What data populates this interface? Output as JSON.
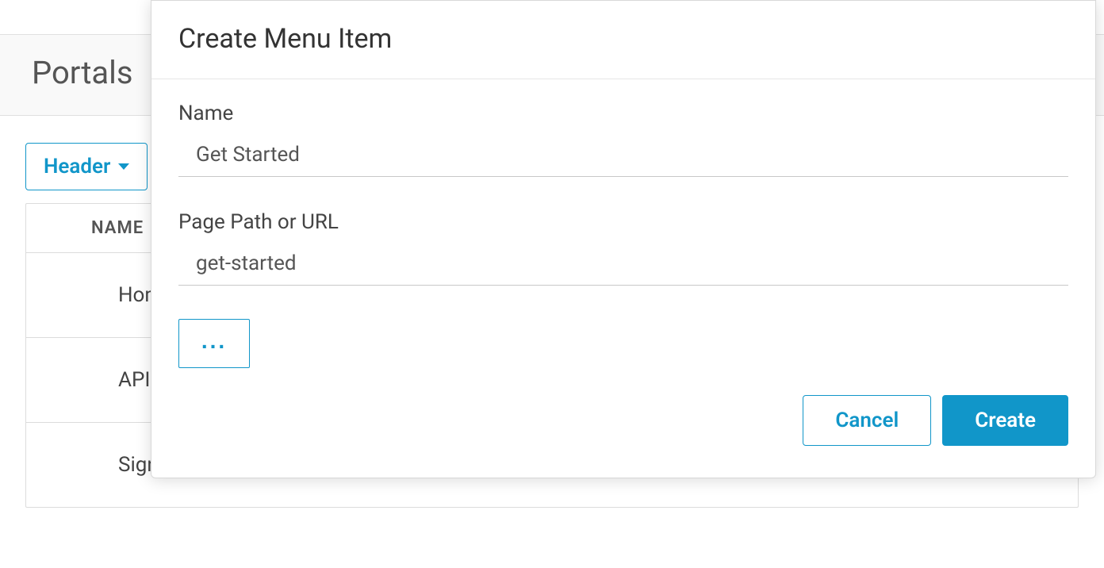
{
  "page": {
    "title": "Portals"
  },
  "dropdown": {
    "label": "Header"
  },
  "table": {
    "header": {
      "name_column": "NAME"
    },
    "rows": [
      {
        "name": "Home"
      },
      {
        "name": "APIs"
      },
      {
        "name": "Sign In"
      }
    ]
  },
  "modal": {
    "title": "Create Menu Item",
    "fields": {
      "name": {
        "label": "Name",
        "value": "Get Started"
      },
      "path": {
        "label": "Page Path or URL",
        "value": "get-started"
      }
    },
    "more_label": "...",
    "buttons": {
      "cancel": "Cancel",
      "create": "Create"
    }
  }
}
